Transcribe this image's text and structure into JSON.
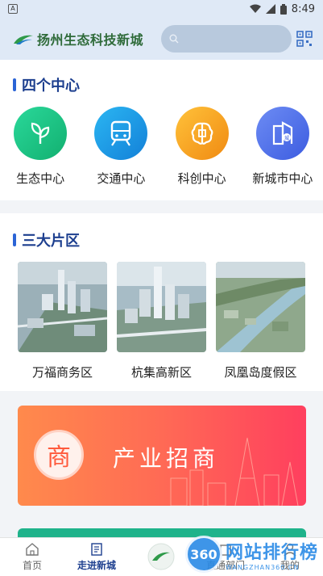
{
  "status_bar": {
    "time": "8:49"
  },
  "app_bar": {
    "logo_text": "扬州生态科技新城",
    "search_placeholder": ""
  },
  "centers_section": {
    "title": "四个中心",
    "items": [
      {
        "label": "生态中心",
        "icon": "leaf-icon",
        "color": "#18c27f"
      },
      {
        "label": "交通中心",
        "icon": "train-icon",
        "color": "#1c9ae8"
      },
      {
        "label": "科创中心",
        "icon": "brain-chip-icon",
        "color": "#f5a21c"
      },
      {
        "label": "新城市中心",
        "icon": "city-building-icon",
        "color": "#4b6fe8"
      }
    ]
  },
  "zones_section": {
    "title": "三大片区",
    "items": [
      {
        "label": "万福商务区"
      },
      {
        "label": "杭集高新区"
      },
      {
        "label": "凤凰岛度假区"
      }
    ]
  },
  "banner": {
    "text": "产业招商",
    "badge": "商"
  },
  "tab_bar": {
    "tabs": [
      {
        "label": "首页",
        "icon": "home-icon",
        "active": false
      },
      {
        "label": "走进新城",
        "icon": "building-doc-icon",
        "active": true
      },
      {
        "label": "",
        "icon": "logo-tab-icon",
        "active": false
      },
      {
        "label": "直通部门",
        "icon": "department-icon",
        "active": false
      },
      {
        "label": "我的",
        "icon": "user-icon",
        "active": false
      }
    ]
  },
  "watermark": {
    "badge": "360",
    "title": "网站排行榜",
    "url": "WANGZHAN360.CN"
  },
  "colors": {
    "accent": "#1d3f8f",
    "appbar_bg": "#dfe9f6",
    "banner_start": "#ff8a4c",
    "banner_end": "#ff3f5e"
  }
}
